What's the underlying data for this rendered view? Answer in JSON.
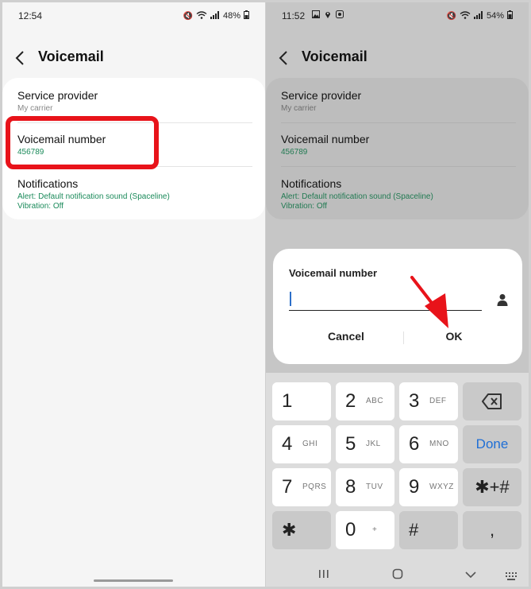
{
  "left": {
    "status": {
      "time": "12:54",
      "battery": "48%"
    },
    "appbar": {
      "title": "Voicemail"
    },
    "items": [
      {
        "title": "Service provider",
        "subtitle": "My carrier"
      },
      {
        "title": "Voicemail number",
        "subtitle": "456789"
      },
      {
        "title": "Notifications",
        "line1": "Alert: Default notification sound (Spaceline)",
        "line2": "Vibration: Off"
      }
    ]
  },
  "right": {
    "status": {
      "time": "11:52",
      "battery": "54%"
    },
    "appbar": {
      "title": "Voicemail"
    },
    "items": [
      {
        "title": "Service provider",
        "subtitle": "My carrier"
      },
      {
        "title": "Voicemail number",
        "subtitle": "456789"
      },
      {
        "title": "Notifications",
        "line1": "Alert: Default notification sound (Spaceline)",
        "line2": "Vibration: Off"
      }
    ],
    "dialog": {
      "title": "Voicemail number",
      "value": "",
      "cancel": "Cancel",
      "ok": "OK"
    },
    "keypad": {
      "keys": [
        {
          "num": "1",
          "letters": ""
        },
        {
          "num": "2",
          "letters": "ABC"
        },
        {
          "num": "3",
          "letters": "DEF"
        },
        {
          "num": "4",
          "letters": "GHI"
        },
        {
          "num": "5",
          "letters": "JKL"
        },
        {
          "num": "6",
          "letters": "MNO"
        },
        {
          "num": "7",
          "letters": "PQRS"
        },
        {
          "num": "8",
          "letters": "TUV"
        },
        {
          "num": "9",
          "letters": "WXYZ"
        },
        {
          "num": "0",
          "letters": "+"
        }
      ],
      "done": "Done",
      "star": "✱",
      "star_plus_hash": "✱+#",
      "hash": "#",
      "comma": ","
    }
  },
  "colors": {
    "highlight": "#e8131a",
    "accent_green": "#1a8a5a",
    "done_blue": "#1f6fd6"
  }
}
